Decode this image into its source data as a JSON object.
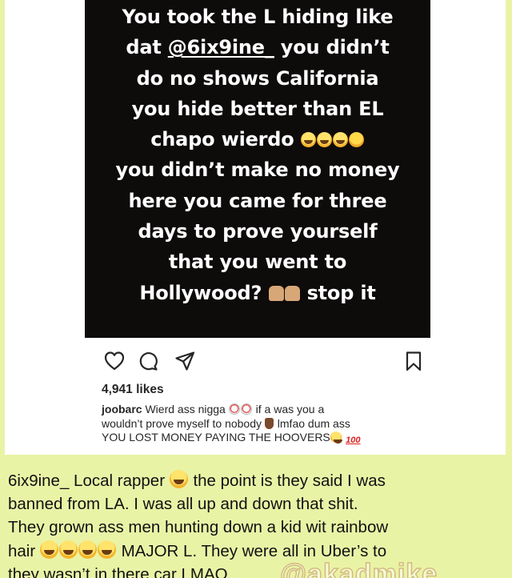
{
  "story": {
    "lines": [
      "You took the L hiding like",
      "dat ",
      "@6ix9ine_",
      " you didn’t",
      "do no shows California",
      "you hide better than EL",
      "chapo wierdo",
      "you didn’t make no money",
      "here you came for three",
      "days to prove yourself",
      "that you went to",
      "Hollywood?",
      "stop it"
    ]
  },
  "post": {
    "likes": "4,941 likes",
    "comment": {
      "username": "joobarc",
      "text_1": "Wierd ass nigga",
      "text_2": "if a was you a",
      "text_3": "wouldn’t prove myself to nobody",
      "text_4": "lmfao dum ass",
      "text_5": "YOU LOST MONEY PAYING THE HOOVERS",
      "hundred": "100"
    }
  },
  "reply": {
    "l1a": "6ix9ine_ Local rapper",
    "l1b": "the point is they said I was",
    "l2": "banned from LA. I was all up and down that shit.",
    "l3": "They grown ass men hunting down a kid wit rainbow",
    "l4a": "hair",
    "l4b": "MAJOR L. They were all in Uber’s to",
    "l5": "they wasn’t in there car LMAO"
  },
  "watermark": "@akadmike",
  "icons": [
    "heart-icon",
    "comment-icon",
    "share-icon",
    "bookmark-icon"
  ],
  "colors": {
    "background": "#e9f3a6",
    "story_card": "#0e0b0b",
    "text": "#262626"
  }
}
